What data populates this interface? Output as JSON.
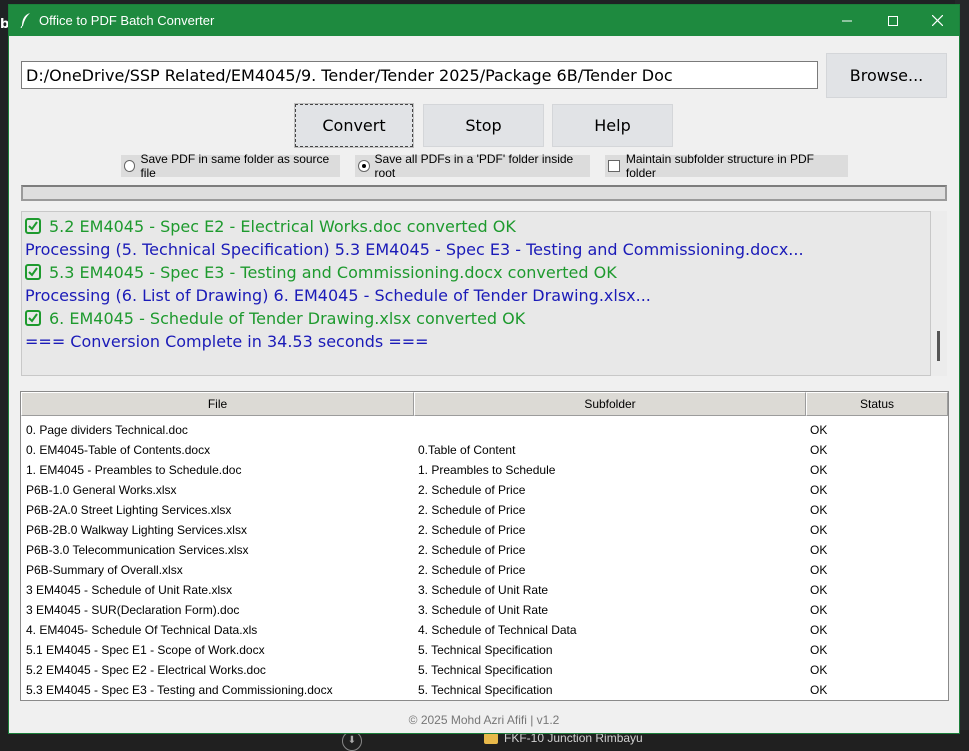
{
  "background": {
    "folder_label": "FKF-10 Junction Rimbayu",
    "left_fragment": "bi"
  },
  "window": {
    "title": "Office to PDF Batch Converter",
    "accent_color": "#1e8a3f"
  },
  "path": {
    "value": "D:/OneDrive/SSP Related/EM4045/9. Tender/Tender 2025/Package 6B/Tender Doc"
  },
  "buttons": {
    "browse": "Browse...",
    "convert": "Convert",
    "stop": "Stop",
    "help": "Help"
  },
  "options": [
    {
      "label": "Save PDF in same folder as source file",
      "type": "radio",
      "selected": false
    },
    {
      "label": "Save all PDFs in a 'PDF' folder inside root",
      "type": "radio",
      "selected": true
    },
    {
      "label": "Maintain subfolder structure in PDF folder",
      "type": "checkbox",
      "checked": false
    }
  ],
  "progress": {
    "value": 0
  },
  "log": [
    {
      "type": "ok",
      "text": "5.2 EM4045 - Spec E2 - Electrical Works.doc converted OK"
    },
    {
      "type": "info",
      "text": "Processing (5. Technical Specification) 5.3 EM4045 - Spec E3 - Testing and Commissioning.docx..."
    },
    {
      "type": "ok",
      "text": "5.3 EM4045 - Spec E3 - Testing and Commissioning.docx converted OK"
    },
    {
      "type": "info",
      "text": "Processing (6. List of Drawing) 6. EM4045 - Schedule of Tender Drawing.xlsx..."
    },
    {
      "type": "ok",
      "text": "6. EM4045 - Schedule of Tender Drawing.xlsx converted OK"
    },
    {
      "type": "info",
      "text": "=== Conversion Complete in 34.53 seconds ==="
    }
  ],
  "table": {
    "headers": [
      "File",
      "Subfolder",
      "Status"
    ],
    "rows": [
      [
        "0.  Page dividers Technical.doc",
        "",
        "OK"
      ],
      [
        "0. EM4045-Table of Contents.docx",
        "0.Table of Content",
        "OK"
      ],
      [
        "1. EM4045 - Preambles to Schedule.doc",
        "1. Preambles to Schedule",
        "OK"
      ],
      [
        "P6B-1.0 General Works.xlsx",
        "2. Schedule of Price",
        "OK"
      ],
      [
        "P6B-2A.0 Street Lighting Services.xlsx",
        "2. Schedule of Price",
        "OK"
      ],
      [
        "P6B-2B.0 Walkway Lighting Services.xlsx",
        "2. Schedule of Price",
        "OK"
      ],
      [
        "P6B-3.0 Telecommunication Services.xlsx",
        "2. Schedule of Price",
        "OK"
      ],
      [
        "P6B-Summary of Overall.xlsx",
        "2. Schedule of Price",
        "OK"
      ],
      [
        "3 EM4045 - Schedule of Unit Rate.xlsx",
        "3. Schedule of Unit Rate",
        "OK"
      ],
      [
        "3 EM4045 - SUR(Declaration Form).doc",
        "3. Schedule of Unit Rate",
        "OK"
      ],
      [
        "4. EM4045- Schedule Of Technical Data.xls",
        "4. Schedule of Technical Data",
        "OK"
      ],
      [
        "5.1 EM4045 - Spec E1 - Scope of Work.docx",
        "5. Technical Specification",
        "OK"
      ],
      [
        "5.2 EM4045 - Spec E2 - Electrical Works.doc",
        "5. Technical Specification",
        "OK"
      ],
      [
        "5.3 EM4045 - Spec E3 - Testing and Commissioning.docx",
        "5. Technical Specification",
        "OK"
      ]
    ]
  },
  "footer": "© 2025 Mohd Azri Afifi | v1.2"
}
